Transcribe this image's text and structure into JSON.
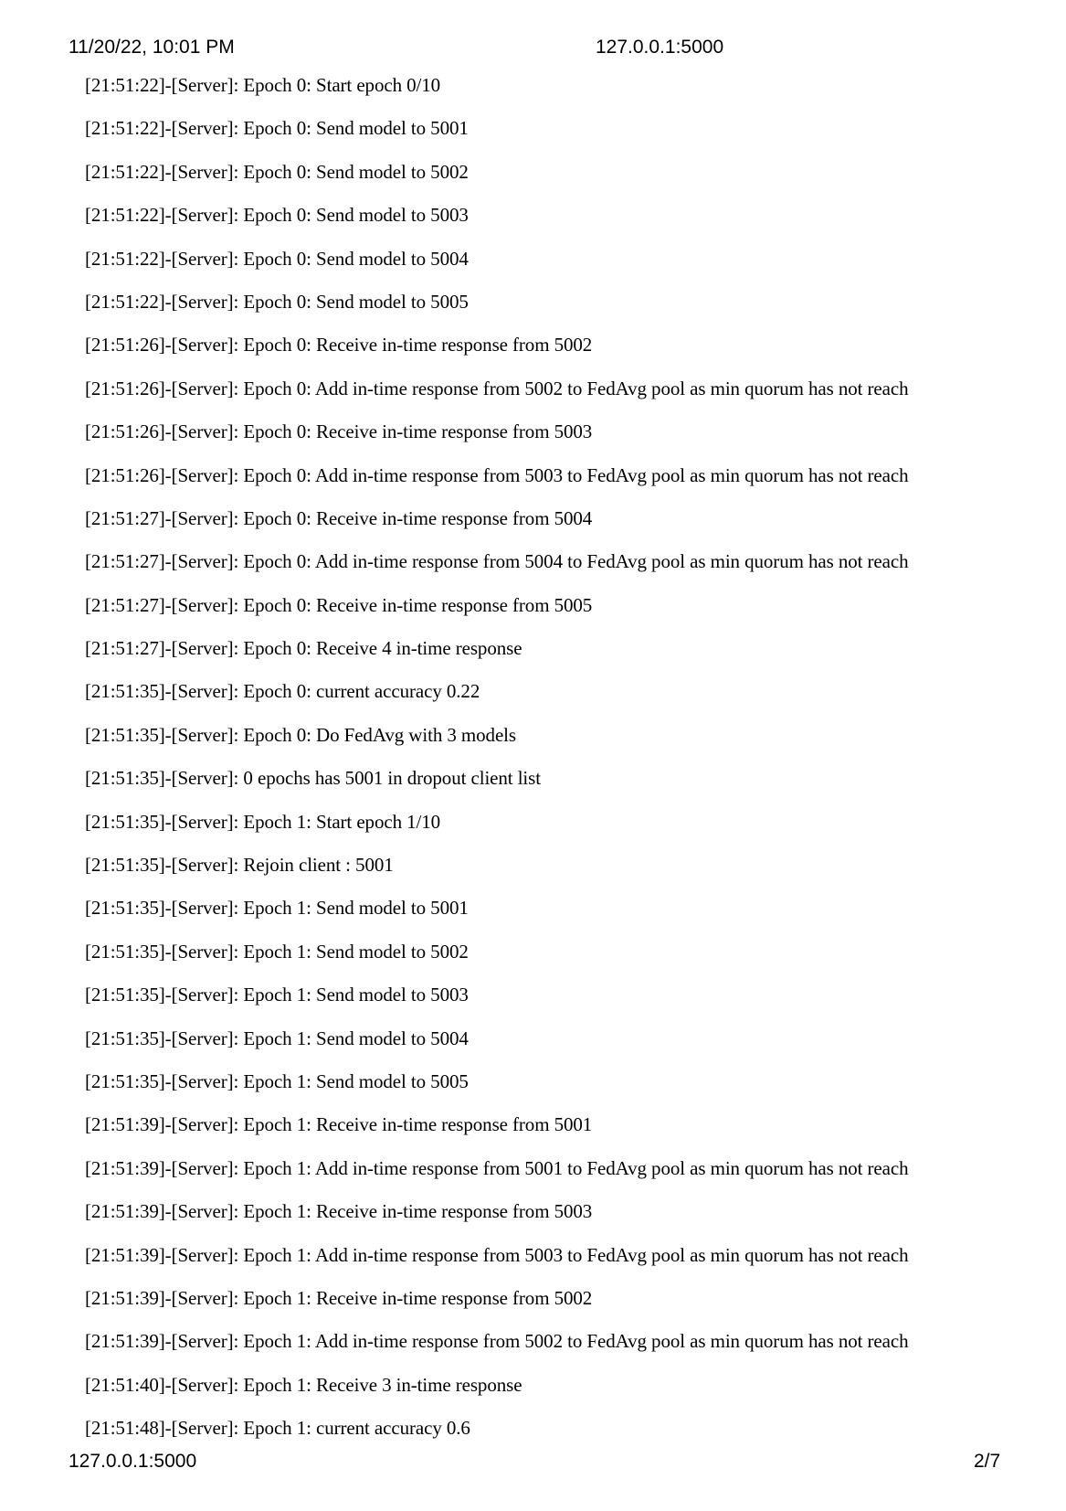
{
  "header": {
    "datetime": "11/20/22, 10:01 PM",
    "url": "127.0.0.1:5000"
  },
  "footer": {
    "url": "127.0.0.1:5000",
    "page": "2/7"
  },
  "log_lines": [
    "[21:51:22]-[Server]: Epoch 0: Start epoch 0/10",
    "[21:51:22]-[Server]: Epoch 0: Send model to 5001",
    "[21:51:22]-[Server]: Epoch 0: Send model to 5002",
    "[21:51:22]-[Server]: Epoch 0: Send model to 5003",
    "[21:51:22]-[Server]: Epoch 0: Send model to 5004",
    "[21:51:22]-[Server]: Epoch 0: Send model to 5005",
    "[21:51:26]-[Server]: Epoch 0: Receive in-time response from 5002",
    "[21:51:26]-[Server]: Epoch 0: Add in-time response from 5002 to FedAvg pool as min quorum has not reach",
    "[21:51:26]-[Server]: Epoch 0: Receive in-time response from 5003",
    "[21:51:26]-[Server]: Epoch 0: Add in-time response from 5003 to FedAvg pool as min quorum has not reach",
    "[21:51:27]-[Server]: Epoch 0: Receive in-time response from 5004",
    "[21:51:27]-[Server]: Epoch 0: Add in-time response from 5004 to FedAvg pool as min quorum has not reach",
    "[21:51:27]-[Server]: Epoch 0: Receive in-time response from 5005",
    "[21:51:27]-[Server]: Epoch 0: Receive 4 in-time response",
    "[21:51:35]-[Server]: Epoch 0: current accuracy 0.22",
    "[21:51:35]-[Server]: Epoch 0: Do FedAvg with 3 models",
    "[21:51:35]-[Server]: 0 epochs has 5001 in dropout client list",
    "[21:51:35]-[Server]: Epoch 1: Start epoch 1/10",
    "[21:51:35]-[Server]: Rejoin client : 5001",
    "[21:51:35]-[Server]: Epoch 1: Send model to 5001",
    "[21:51:35]-[Server]: Epoch 1: Send model to 5002",
    "[21:51:35]-[Server]: Epoch 1: Send model to 5003",
    "[21:51:35]-[Server]: Epoch 1: Send model to 5004",
    "[21:51:35]-[Server]: Epoch 1: Send model to 5005",
    "[21:51:39]-[Server]: Epoch 1: Receive in-time response from 5001",
    "[21:51:39]-[Server]: Epoch 1: Add in-time response from 5001 to FedAvg pool as min quorum has not reach",
    "[21:51:39]-[Server]: Epoch 1: Receive in-time response from 5003",
    "[21:51:39]-[Server]: Epoch 1: Add in-time response from 5003 to FedAvg pool as min quorum has not reach",
    "[21:51:39]-[Server]: Epoch 1: Receive in-time response from 5002",
    "[21:51:39]-[Server]: Epoch 1: Add in-time response from 5002 to FedAvg pool as min quorum has not reach",
    "[21:51:40]-[Server]: Epoch 1: Receive 3 in-time response",
    "[21:51:48]-[Server]: Epoch 1: current accuracy 0.6"
  ]
}
